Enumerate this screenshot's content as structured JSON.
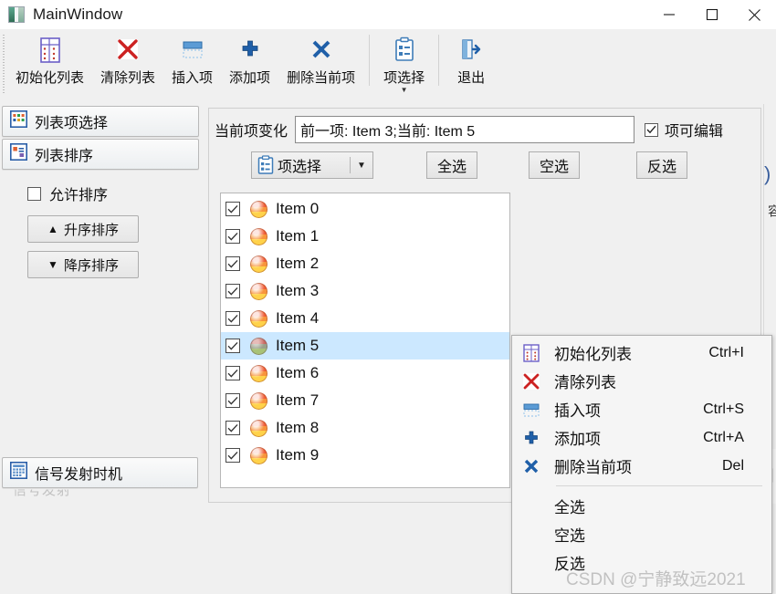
{
  "window": {
    "title": "MainWindow",
    "icon": "app-icon",
    "controls": [
      {
        "name": "minimize",
        "glyph": "minimize-icon"
      },
      {
        "name": "maximize",
        "glyph": "maximize-icon"
      },
      {
        "name": "close",
        "glyph": "close-icon"
      }
    ]
  },
  "toolbar": {
    "items": [
      {
        "label": "初始化列表",
        "icon": "init-list-icon",
        "has_menu_arrow": false
      },
      {
        "label": "清除列表",
        "icon": "clear-list-icon",
        "has_menu_arrow": false
      },
      {
        "label": "插入项",
        "icon": "insert-item-icon",
        "has_menu_arrow": false
      },
      {
        "label": "添加项",
        "icon": "add-item-icon",
        "has_menu_arrow": false
      },
      {
        "label": "删除当前项",
        "icon": "delete-current-item-icon",
        "has_menu_arrow": false
      },
      {
        "label": "项选择",
        "icon": "item-select-icon",
        "has_menu_arrow": true
      },
      {
        "label": "退出",
        "icon": "exit-icon",
        "has_menu_arrow": false
      }
    ]
  },
  "sidebar": {
    "sections": [
      {
        "label": "列表项选择",
        "icon": "list-item-select-icon"
      },
      {
        "label": "列表排序",
        "icon": "list-sort-icon"
      }
    ],
    "allow_sort": {
      "label": "允许排序",
      "checked": false
    },
    "buttons": [
      {
        "label": "升序排序",
        "icon": "triangle-up-icon"
      },
      {
        "label": "降序排序",
        "icon": "triangle-down-icon"
      }
    ],
    "footer": {
      "label": "信号发射时机",
      "icon": "signal-timing-icon"
    },
    "footer_ghost": "信号发射"
  },
  "main": {
    "current_item_changed": {
      "caption": "当前项变化",
      "value": "前一项: Item 3;当前: Item 5",
      "placeholder": ""
    },
    "item_editable": {
      "label": "项可编辑",
      "checked": true
    },
    "combo": {
      "text": "项选择",
      "icon": "item-select-icon",
      "arrow": "chevron-down-icon"
    },
    "buttons": [
      {
        "label": "全选"
      },
      {
        "label": "空选"
      },
      {
        "label": "反选"
      }
    ],
    "list": {
      "items": [
        {
          "label": "Item 0",
          "checked": true,
          "selected": false
        },
        {
          "label": "Item 1",
          "checked": true,
          "selected": false
        },
        {
          "label": "Item 2",
          "checked": true,
          "selected": false
        },
        {
          "label": "Item 3",
          "checked": true,
          "selected": false
        },
        {
          "label": "Item 4",
          "checked": true,
          "selected": false
        },
        {
          "label": "Item 5",
          "checked": true,
          "selected": true
        },
        {
          "label": "Item 6",
          "checked": true,
          "selected": false
        },
        {
          "label": "Item 7",
          "checked": true,
          "selected": false
        },
        {
          "label": "Item 8",
          "checked": true,
          "selected": false
        },
        {
          "label": "Item 9",
          "checked": true,
          "selected": false
        }
      ]
    }
  },
  "context_menu": {
    "items": [
      {
        "label": "初始化列表",
        "shortcut": "Ctrl+I",
        "icon": "init-list-icon"
      },
      {
        "label": "清除列表",
        "shortcut": "",
        "icon": "clear-list-icon"
      },
      {
        "label": "插入项",
        "shortcut": "Ctrl+S",
        "icon": "insert-item-icon"
      },
      {
        "label": "添加项",
        "shortcut": "Ctrl+A",
        "icon": "add-item-icon"
      },
      {
        "label": "删除当前项",
        "shortcut": "Del",
        "icon": "delete-current-item-icon"
      },
      {
        "separator": true
      },
      {
        "label": "全选",
        "shortcut": "",
        "icon": ""
      },
      {
        "label": "空选",
        "shortcut": "",
        "icon": ""
      },
      {
        "label": "反选",
        "shortcut": "",
        "icon": ""
      }
    ]
  },
  "edge": {
    "paren": ")",
    "vtext": "容",
    "dash": "-|"
  },
  "watermark": {
    "text": "CSDN @宁静致远2021"
  },
  "colors": {
    "selection": "#cce8ff",
    "accent_blue": "#1a5fb4",
    "clear_red": "#cc2222",
    "window_bg": "#f0f0f0"
  }
}
